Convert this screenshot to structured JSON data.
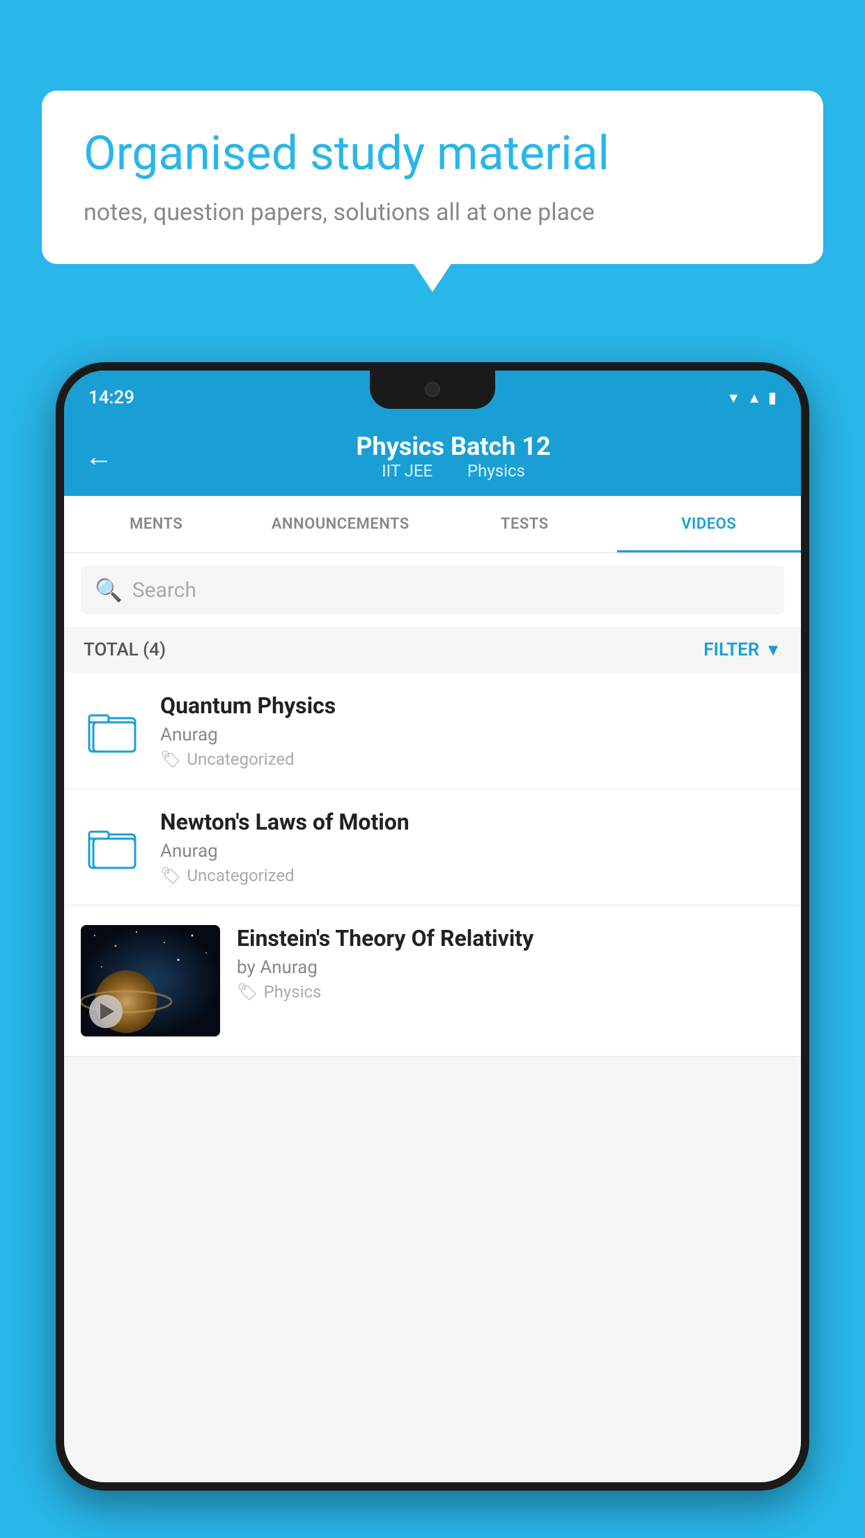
{
  "background_color": "#29b6e8",
  "speech_bubble": {
    "title": "Organised study material",
    "subtitle": "notes, question papers, solutions all at one place"
  },
  "status_bar": {
    "time": "14:29",
    "wifi": "▼",
    "signal": "▲",
    "battery": "▮"
  },
  "header": {
    "title": "Physics Batch 12",
    "subtitle_part1": "IIT JEE",
    "subtitle_part2": "Physics",
    "back_label": "←"
  },
  "tabs": [
    {
      "label": "MENTS",
      "active": false
    },
    {
      "label": "ANNOUNCEMENTS",
      "active": false
    },
    {
      "label": "TESTS",
      "active": false
    },
    {
      "label": "VIDEOS",
      "active": true
    }
  ],
  "search": {
    "placeholder": "Search"
  },
  "filter_bar": {
    "total_label": "TOTAL (4)",
    "filter_label": "FILTER"
  },
  "videos": [
    {
      "title": "Quantum Physics",
      "author": "Anurag",
      "tag": "Uncategorized",
      "has_thumbnail": false
    },
    {
      "title": "Newton's Laws of Motion",
      "author": "Anurag",
      "tag": "Uncategorized",
      "has_thumbnail": false
    },
    {
      "title": "Einstein's Theory Of Relativity",
      "author": "by Anurag",
      "tag": "Physics",
      "has_thumbnail": true
    }
  ],
  "icons": {
    "back": "←",
    "search": "🔍",
    "filter": "▼",
    "tag": "🏷",
    "play": "▶"
  }
}
